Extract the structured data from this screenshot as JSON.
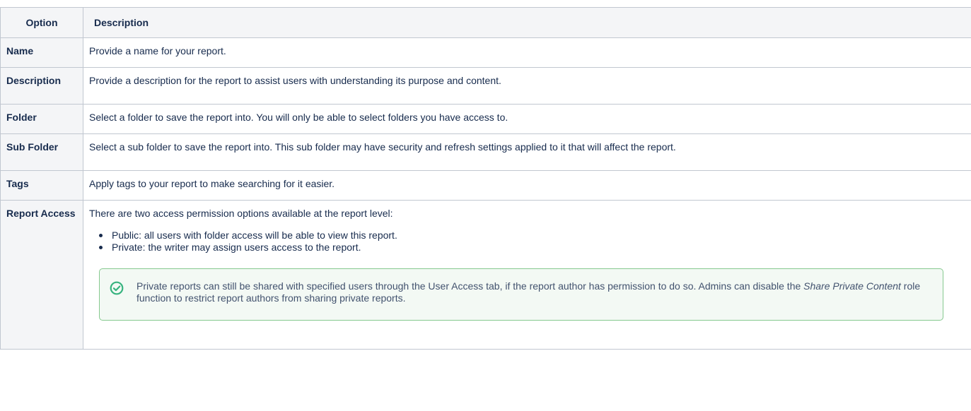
{
  "header": {
    "option": "Option",
    "description": "Description"
  },
  "rows": [
    {
      "option": "Name",
      "description": "Provide a name for your report."
    },
    {
      "option": "Description",
      "description": "Provide a description for the report to assist users with understanding its purpose and content."
    },
    {
      "option": "Folder",
      "description": "Select a folder to save the report into. You will only be able to select folders you have access to."
    },
    {
      "option": "Sub Folder",
      "description": "Select a sub folder to save the report into. This sub folder may have security and refresh settings applied to it that will affect the report."
    },
    {
      "option": "Tags",
      "description": "Apply tags to your report to make searching for it easier."
    },
    {
      "option": "Report Access",
      "description": "There are two access permission options available at the report level:",
      "bullets": [
        "Public: all users with folder access will be able to view this report.",
        "Private: the writer may assign users access to the report."
      ],
      "tip": {
        "icon": "check-circle-icon",
        "text_before": "Private reports can still be shared with specified users through the User Access tab, if the report author has permission to do so. Admins can disable the ",
        "emphasis": "Share Private Content",
        "text_after": " role function to restrict report authors from sharing private reports."
      }
    }
  ],
  "colors": {
    "header_bg": "#f4f5f7",
    "border": "#c1c7d0",
    "tip_border": "#86c98f",
    "tip_bg": "#f3f9f4",
    "tip_icon": "#36b37e"
  }
}
